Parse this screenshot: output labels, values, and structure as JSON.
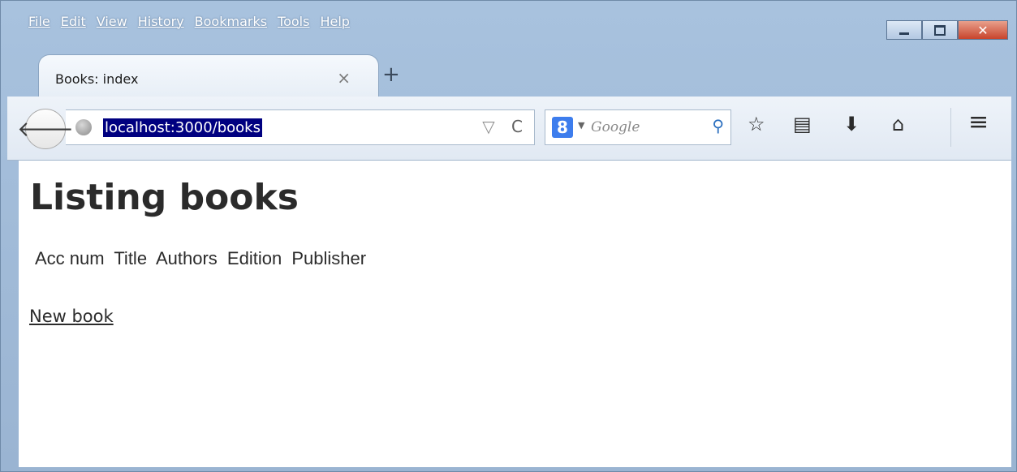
{
  "menu": [
    "File",
    "Edit",
    "View",
    "History",
    "Bookmarks",
    "Tools",
    "Help"
  ],
  "tab": {
    "title": "Books: index",
    "close_glyph": "×",
    "new_tab_glyph": "+"
  },
  "window_controls": {
    "close_glyph": "✕"
  },
  "toolbar": {
    "back_glyph": "🡐",
    "url": "localhost:3000/books",
    "dropdown_glyph": "▽",
    "reload_glyph": "C",
    "search_engine_glyph": "8",
    "search_caret": "▼",
    "search_placeholder": "Google",
    "search_go_glyph": "⚲",
    "bookmark_glyph": "☆",
    "reading_glyph": "▤",
    "download_glyph": "⬇",
    "home_glyph": "⌂",
    "menu_glyph": "≡"
  },
  "page": {
    "title": "Listing books",
    "columns": [
      "Acc num",
      "Title",
      "Authors",
      "Edition",
      "Publisher"
    ],
    "new_link": "New book"
  }
}
